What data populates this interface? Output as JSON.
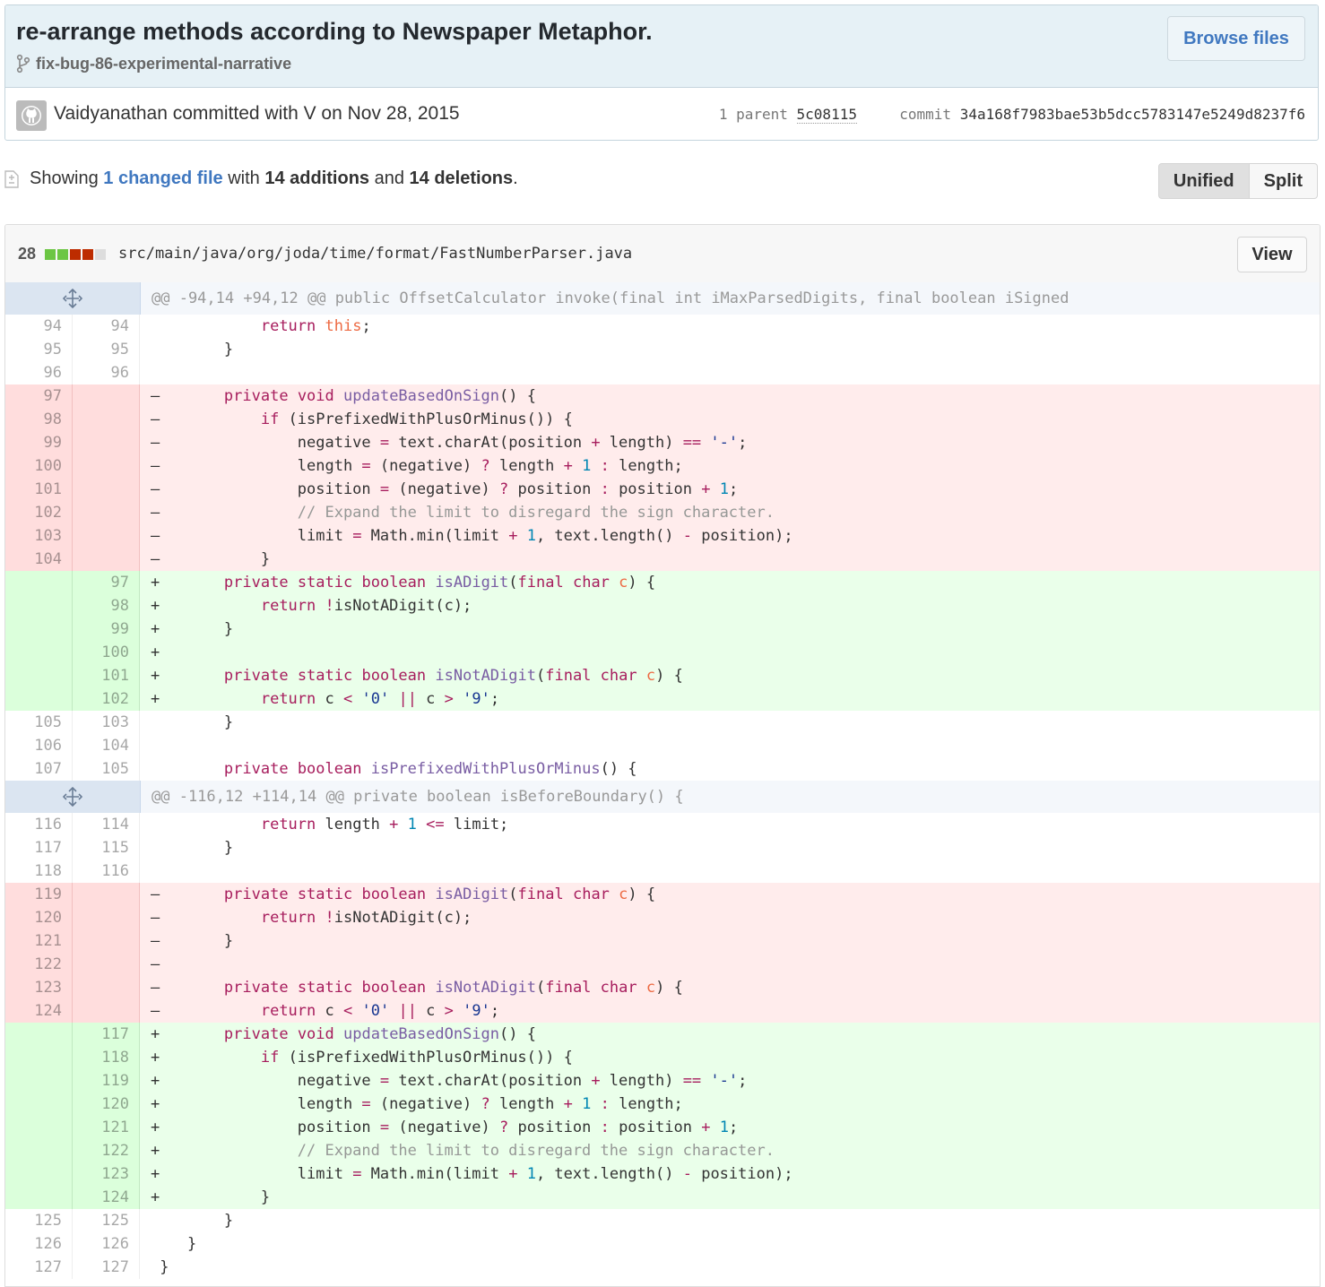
{
  "commit": {
    "title": "re-arrange methods according to Newspaper Metaphor.",
    "branch": "fix-bug-86-experimental-narrative",
    "browse_label": "Browse files",
    "author_line": "Vaidyanathan committed with V on Nov 28, 2015",
    "parent_label": "1 parent",
    "parent_sha": "5c08115",
    "commit_label": "commit",
    "sha": "34a168f7983bae53b5dcc5783147e5249d8237f6"
  },
  "toc": {
    "prefix": "Showing ",
    "changed_link": "1 changed file",
    "mid1": " with ",
    "additions": "14 additions",
    "mid2": " and ",
    "deletions": "14 deletions",
    "suffix": ".",
    "unified_label": "Unified",
    "split_label": "Split"
  },
  "file": {
    "changes": "28",
    "path": "src/main/java/org/joda/time/format/FastNumberParser.java",
    "view_label": "View",
    "diffstat_blocks": [
      "add",
      "add",
      "del",
      "del",
      "neutral"
    ]
  },
  "colors": {
    "deleted_bg": "#ffecec",
    "added_bg": "#eaffea",
    "keyword": "#a71d5d",
    "function": "#795da3",
    "string": "#183691",
    "number": "#0086b3",
    "link": "#4078c0"
  },
  "diff_lines": [
    {
      "type": "hunk",
      "text": "@@ -94,14 +94,12 @@ public OffsetCalculator invoke(final int iMaxParsedDigits, final boolean iSigned"
    },
    {
      "type": "ctx",
      "old": "94",
      "new": "94",
      "text": "            return this;"
    },
    {
      "type": "ctx",
      "old": "95",
      "new": "95",
      "text": "        }"
    },
    {
      "type": "ctx",
      "old": "96",
      "new": "96",
      "text": ""
    },
    {
      "type": "del",
      "old": "97",
      "new": "",
      "text": "-       private void updateBasedOnSign() {"
    },
    {
      "type": "del",
      "old": "98",
      "new": "",
      "text": "-           if (isPrefixedWithPlusOrMinus()) {"
    },
    {
      "type": "del",
      "old": "99",
      "new": "",
      "text": "-               negative = text.charAt(position + length) == '-';"
    },
    {
      "type": "del",
      "old": "100",
      "new": "",
      "text": "-               length = (negative) ? length + 1 : length;"
    },
    {
      "type": "del",
      "old": "101",
      "new": "",
      "text": "-               position = (negative) ? position : position + 1;"
    },
    {
      "type": "del",
      "old": "102",
      "new": "",
      "text": "-               // Expand the limit to disregard the sign character."
    },
    {
      "type": "del",
      "old": "103",
      "new": "",
      "text": "-               limit = Math.min(limit + 1, text.length() - position);"
    },
    {
      "type": "del",
      "old": "104",
      "new": "",
      "text": "-           }"
    },
    {
      "type": "add",
      "old": "",
      "new": "97",
      "text": "+       private static boolean isADigit(final char c) {"
    },
    {
      "type": "add",
      "old": "",
      "new": "98",
      "text": "+           return !isNotADigit(c);"
    },
    {
      "type": "add",
      "old": "",
      "new": "99",
      "text": "+       }"
    },
    {
      "type": "add",
      "old": "",
      "new": "100",
      "text": "+"
    },
    {
      "type": "add",
      "old": "",
      "new": "101",
      "text": "+       private static boolean isNotADigit(final char c) {"
    },
    {
      "type": "add",
      "old": "",
      "new": "102",
      "text": "+           return c < '0' || c > '9';"
    },
    {
      "type": "ctx",
      "old": "105",
      "new": "103",
      "text": "        }"
    },
    {
      "type": "ctx",
      "old": "106",
      "new": "104",
      "text": ""
    },
    {
      "type": "ctx",
      "old": "107",
      "new": "105",
      "text": "        private boolean isPrefixedWithPlusOrMinus() {"
    },
    {
      "type": "hunk",
      "text": "@@ -116,12 +114,14 @@ private boolean isBeforeBoundary() {"
    },
    {
      "type": "ctx",
      "old": "116",
      "new": "114",
      "text": "            return length + 1 <= limit;"
    },
    {
      "type": "ctx",
      "old": "117",
      "new": "115",
      "text": "        }"
    },
    {
      "type": "ctx",
      "old": "118",
      "new": "116",
      "text": ""
    },
    {
      "type": "del",
      "old": "119",
      "new": "",
      "text": "-       private static boolean isADigit(final char c) {"
    },
    {
      "type": "del",
      "old": "120",
      "new": "",
      "text": "-           return !isNotADigit(c);"
    },
    {
      "type": "del",
      "old": "121",
      "new": "",
      "text": "-       }"
    },
    {
      "type": "del",
      "old": "122",
      "new": "",
      "text": "-"
    },
    {
      "type": "del",
      "old": "123",
      "new": "",
      "text": "-       private static boolean isNotADigit(final char c) {"
    },
    {
      "type": "del",
      "old": "124",
      "new": "",
      "text": "-           return c < '0' || c > '9';"
    },
    {
      "type": "add",
      "old": "",
      "new": "117",
      "text": "+       private void updateBasedOnSign() {"
    },
    {
      "type": "add",
      "old": "",
      "new": "118",
      "text": "+           if (isPrefixedWithPlusOrMinus()) {"
    },
    {
      "type": "add",
      "old": "",
      "new": "119",
      "text": "+               negative = text.charAt(position + length) == '-';"
    },
    {
      "type": "add",
      "old": "",
      "new": "120",
      "text": "+               length = (negative) ? length + 1 : length;"
    },
    {
      "type": "add",
      "old": "",
      "new": "121",
      "text": "+               position = (negative) ? position : position + 1;"
    },
    {
      "type": "add",
      "old": "",
      "new": "122",
      "text": "+               // Expand the limit to disregard the sign character."
    },
    {
      "type": "add",
      "old": "",
      "new": "123",
      "text": "+               limit = Math.min(limit + 1, text.length() - position);"
    },
    {
      "type": "add",
      "old": "",
      "new": "124",
      "text": "+           }"
    },
    {
      "type": "ctx",
      "old": "125",
      "new": "125",
      "text": "        }"
    },
    {
      "type": "ctx",
      "old": "126",
      "new": "126",
      "text": "    }"
    },
    {
      "type": "ctx",
      "old": "127",
      "new": "127",
      "text": " }"
    }
  ]
}
